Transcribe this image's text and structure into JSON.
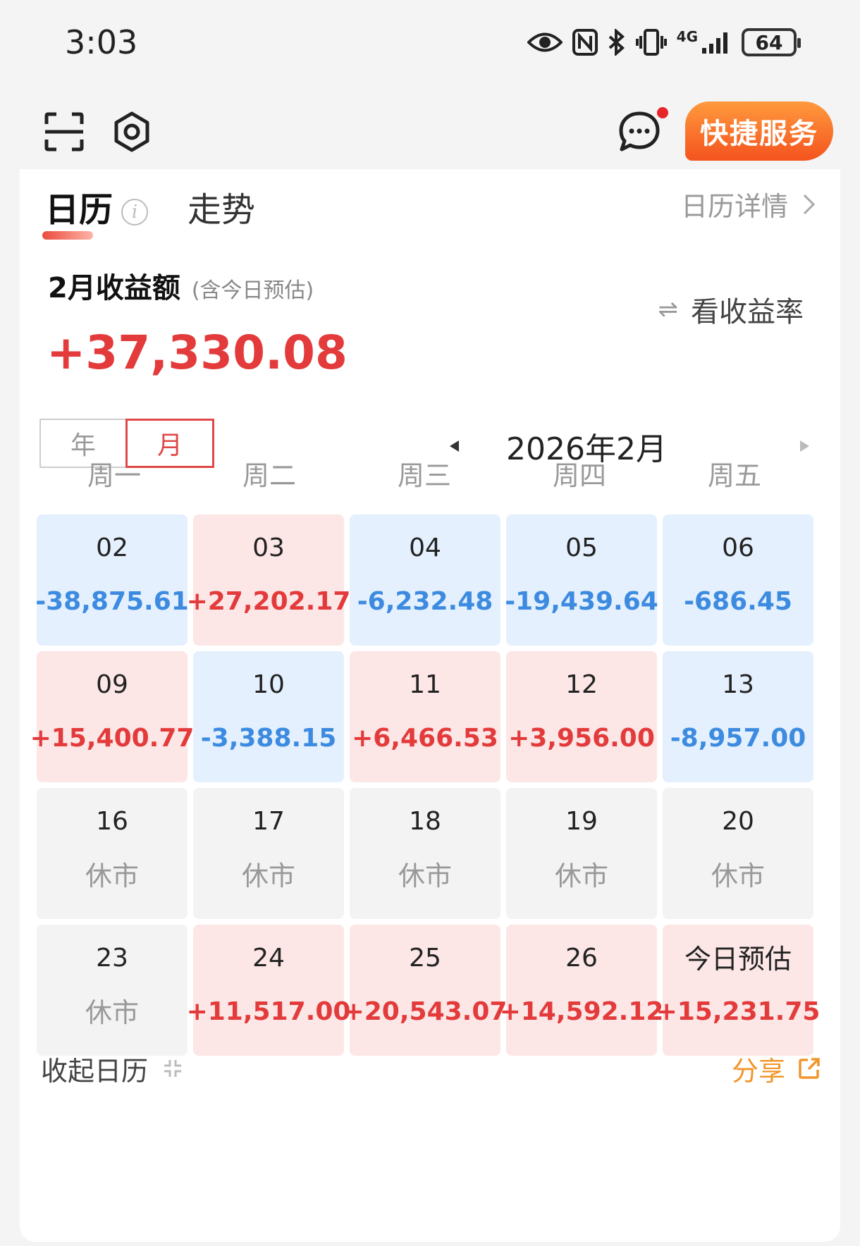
{
  "status_bar": {
    "time": "3:03",
    "network": "4G",
    "battery": "64",
    "icons": [
      "eye-icon",
      "nfc-icon",
      "bluetooth-icon",
      "vibrate-icon",
      "signal-icon",
      "battery-icon"
    ]
  },
  "toolbar": {
    "quick_service": "快捷服务",
    "icons": [
      "scan-icon",
      "settings-icon",
      "message-icon"
    ],
    "accent": "#f4531e"
  },
  "tabs": {
    "calendar": "日历",
    "trend": "走势",
    "detail_link": "日历详情"
  },
  "summary": {
    "title": "2月收益额",
    "subtitle": "(含今日预估)",
    "value": "+37,330.08",
    "view_rate": "看收益率"
  },
  "period": {
    "year": "年",
    "month": "月",
    "selected": "月",
    "current": "2026年2月"
  },
  "weekdays": [
    "周一",
    "周二",
    "周三",
    "周四",
    "周五"
  ],
  "days": [
    {
      "day": "02",
      "value": "-38,875.61",
      "type": "loss"
    },
    {
      "day": "03",
      "value": "+27,202.17",
      "type": "gain"
    },
    {
      "day": "04",
      "value": "-6,232.48",
      "type": "loss"
    },
    {
      "day": "05",
      "value": "-19,439.64",
      "type": "loss"
    },
    {
      "day": "06",
      "value": "-686.45",
      "type": "loss"
    },
    {
      "day": "09",
      "value": "+15,400.77",
      "type": "gain"
    },
    {
      "day": "10",
      "value": "-3,388.15",
      "type": "loss"
    },
    {
      "day": "11",
      "value": "+6,466.53",
      "type": "gain"
    },
    {
      "day": "12",
      "value": "+3,956.00",
      "type": "gain"
    },
    {
      "day": "13",
      "value": "-8,957.00",
      "type": "loss"
    },
    {
      "day": "16",
      "value": "休市",
      "type": "closed"
    },
    {
      "day": "17",
      "value": "休市",
      "type": "closed"
    },
    {
      "day": "18",
      "value": "休市",
      "type": "closed"
    },
    {
      "day": "19",
      "value": "休市",
      "type": "closed"
    },
    {
      "day": "20",
      "value": "休市",
      "type": "closed"
    },
    {
      "day": "23",
      "value": "休市",
      "type": "closed"
    },
    {
      "day": "24",
      "value": "+11,517.00",
      "type": "gain"
    },
    {
      "day": "25",
      "value": "+20,543.07",
      "type": "gain"
    },
    {
      "day": "26",
      "value": "+14,592.12",
      "type": "gain"
    },
    {
      "day": "今日预估",
      "value": "+15,231.75",
      "type": "gain"
    }
  ],
  "footer": {
    "collapse": "收起日历",
    "share": "分享"
  },
  "colors": {
    "gain": "#e33b3b",
    "loss": "#3d8be0",
    "share": "#f1962b"
  }
}
